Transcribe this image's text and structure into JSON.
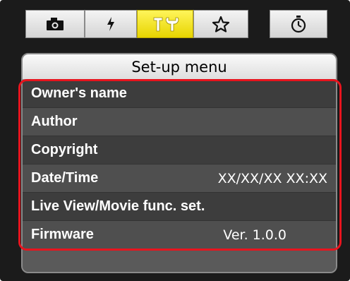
{
  "tabs": [
    {
      "icon": "camera-icon"
    },
    {
      "icon": "flash-icon"
    },
    {
      "icon": "setup-wrench-icon",
      "active": true
    },
    {
      "icon": "star-icon"
    },
    {
      "icon": "timer-icon"
    }
  ],
  "panel": {
    "title": "Set-up menu",
    "items": [
      {
        "label": "Owner's name",
        "value": ""
      },
      {
        "label": "Author",
        "value": ""
      },
      {
        "label": "Copyright",
        "value": ""
      },
      {
        "label": "Date/Time",
        "value": "XX/XX/XX XX:XX"
      },
      {
        "label": "Live View/Movie func. set.",
        "value": ""
      },
      {
        "label": "Firmware",
        "value": "Ver. 1.0.0"
      }
    ]
  },
  "colors": {
    "active_tab": "#f7e700",
    "highlight": "#e8141e",
    "panel": "#5a5a5a"
  }
}
